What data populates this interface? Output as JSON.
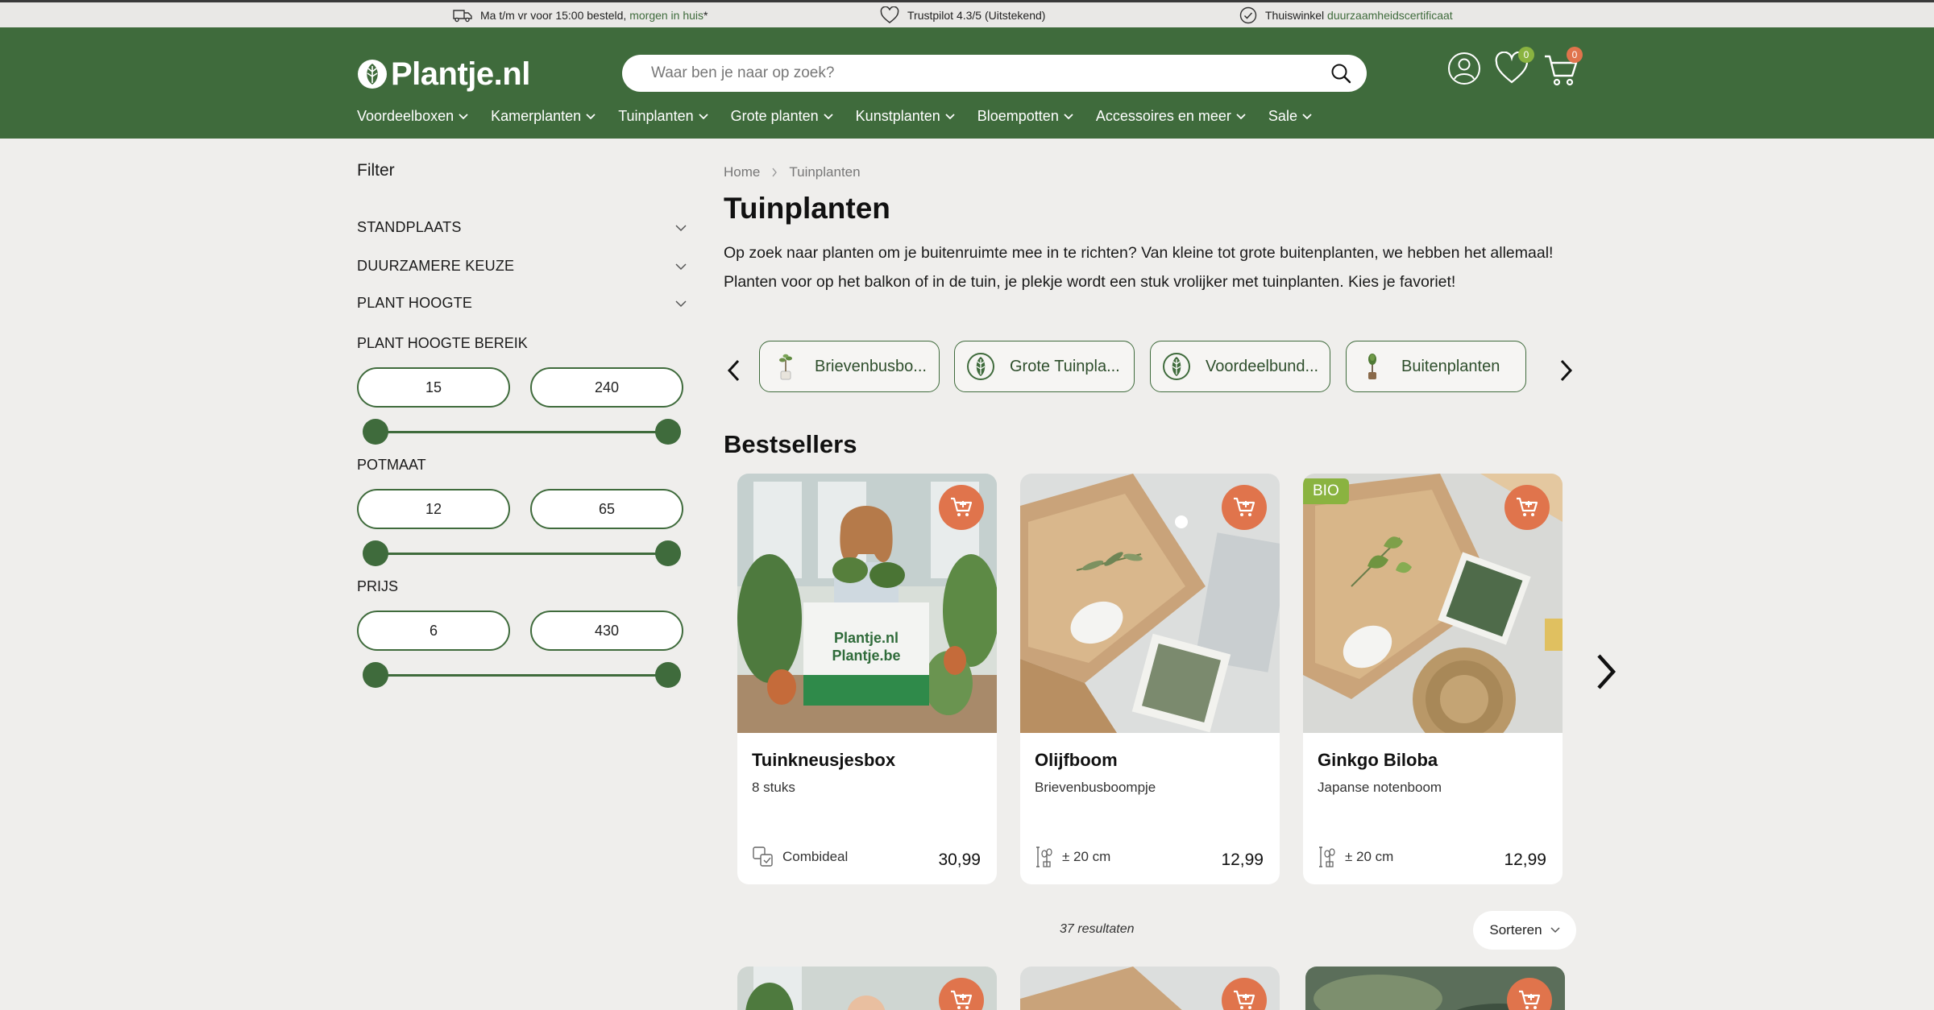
{
  "topbar": {
    "delivery_text": "Ma t/m vr voor 15:00 besteld, ",
    "delivery_accent": "morgen in huis",
    "delivery_suffix": "*",
    "trustpilot_text": "Trustpilot 4.3/5 (Uitstekend)",
    "sustain_text": "Thuiswinkel ",
    "sustain_accent": "duurzaamheidscertificaat"
  },
  "header": {
    "logo_text": "Plantje.nl",
    "search_placeholder": "Waar ben je naar op zoek?",
    "wishlist_count": "0",
    "cart_count": "0"
  },
  "nav": {
    "items": [
      {
        "label": "Voordeelboxen"
      },
      {
        "label": "Kamerplanten"
      },
      {
        "label": "Tuinplanten"
      },
      {
        "label": "Grote planten"
      },
      {
        "label": "Kunstplanten"
      },
      {
        "label": "Bloempotten"
      },
      {
        "label": "Accessoires en meer"
      },
      {
        "label": "Sale"
      }
    ]
  },
  "filters": {
    "title": "Filter",
    "collapsibles": [
      "STANDPLAATS",
      "DUURZAMERE KEUZE",
      "PLANT HOOGTE"
    ],
    "height_range": {
      "label": "PLANT HOOGTE BEREIK",
      "min": "15",
      "max": "240"
    },
    "pot_size": {
      "label": "POTMAAT",
      "min": "12",
      "max": "65"
    },
    "price": {
      "label": "PRIJS",
      "min": "6",
      "max": "430"
    }
  },
  "breadcrumb": {
    "home": "Home",
    "current": "Tuinplanten"
  },
  "page": {
    "title": "Tuinplanten",
    "intro": "Op zoek naar planten om je buitenruimte mee in te richten? Van kleine tot grote buitenplanten, we hebben het allemaal! Planten voor op het balkon of in de tuin, je plekje wordt een stuk vrolijker met tuinplanten. Kies je favoriet!"
  },
  "categories": [
    {
      "label": "Brievenbusbo..."
    },
    {
      "label": "Grote Tuinpla..."
    },
    {
      "label": "Voordeelbund..."
    },
    {
      "label": "Buitenplanten"
    }
  ],
  "bestsellers": {
    "title": "Bestsellers",
    "products": [
      {
        "name": "Tuinkneusjesbox",
        "subtitle": "8 stuks",
        "meta": "Combideal",
        "price": "30,99",
        "badge": ""
      },
      {
        "name": "Olijfboom",
        "subtitle": "Brievenbusboompje",
        "meta": "± 20 cm",
        "price": "12,99",
        "badge": ""
      },
      {
        "name": "Ginkgo Biloba",
        "subtitle": "Japanse notenboom",
        "meta": "± 20 cm",
        "price": "12,99",
        "badge": "BIO"
      }
    ]
  },
  "listing": {
    "results": "37 resultaten",
    "sort_label": "Sorteren"
  },
  "colors": {
    "brand_green": "#3f6b3c",
    "accent_orange": "#e0744c",
    "bio_green": "#8ab340",
    "background": "#efeeec"
  }
}
